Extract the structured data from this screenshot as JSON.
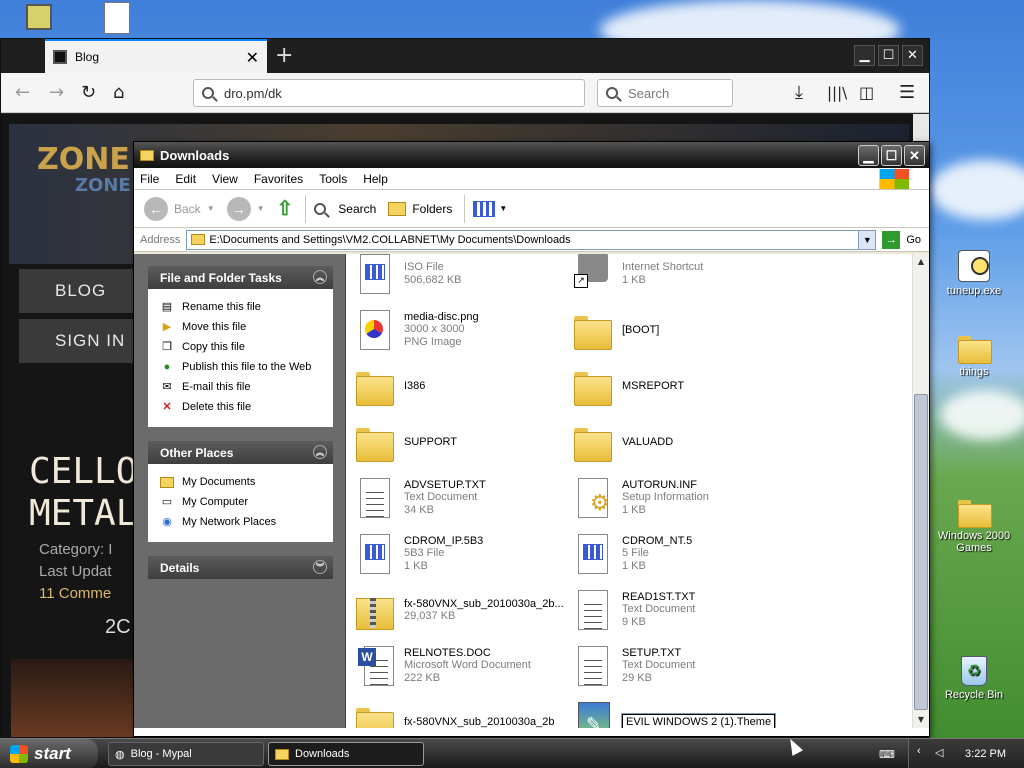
{
  "desktop": {
    "icons": [
      {
        "label": "tuneup.exe",
        "icon": "clock-exe-icon"
      },
      {
        "label": "things",
        "icon": "folder-icon"
      },
      {
        "label": "Windows 2000 Games",
        "icon": "folder-icon"
      },
      {
        "label": "Recycle Bin",
        "icon": "recycle-bin-icon"
      }
    ]
  },
  "browser": {
    "tab_title": "Blog",
    "url": "dro.pm/dk",
    "search_placeholder": "Search",
    "page": {
      "logo": "ZONE",
      "logo_sub": "ZONE",
      "menu": [
        "BLOG",
        "SIGN IN"
      ],
      "post_title_line1": "CELLO",
      "post_title_line2": "METAL",
      "meta": [
        "Category: I",
        "Last Updat",
        "11 Comme"
      ],
      "date_fragment": "2C"
    }
  },
  "explorer": {
    "title": "Downloads",
    "menu": [
      "File",
      "Edit",
      "View",
      "Favorites",
      "Tools",
      "Help"
    ],
    "toolbar": {
      "back": "Back",
      "search": "Search",
      "folders": "Folders"
    },
    "address_label": "Address",
    "address": "E:\\Documents and Settings\\VM2.COLLABNET\\My Documents\\Downloads",
    "go": "Go",
    "file_tasks": {
      "title": "File and Folder Tasks",
      "items": [
        "Rename this file",
        "Move this file",
        "Copy this file",
        "Publish this file to the Web",
        "E-mail this file",
        "Delete this file"
      ]
    },
    "other_places": {
      "title": "Other Places",
      "items": [
        "My Documents",
        "My Computer",
        "My Network Places"
      ]
    },
    "details_title": "Details",
    "files": [
      {
        "name": "",
        "type": "ISO File",
        "size": "506,682 KB",
        "icon": "grid"
      },
      {
        "name": "",
        "type": "Internet Shortcut",
        "size": "1 KB",
        "icon": "shortcut"
      },
      {
        "name": "media-disc.png",
        "type": "3000 x 3000",
        "size": "PNG Image",
        "icon": "img"
      },
      {
        "name": "[BOOT]",
        "type": "",
        "size": "",
        "icon": "folder"
      },
      {
        "name": "I386",
        "type": "",
        "size": "",
        "icon": "folder"
      },
      {
        "name": "MSREPORT",
        "type": "",
        "size": "",
        "icon": "folder"
      },
      {
        "name": "SUPPORT",
        "type": "",
        "size": "",
        "icon": "folder"
      },
      {
        "name": "VALUADD",
        "type": "",
        "size": "",
        "icon": "folder"
      },
      {
        "name": "ADVSETUP.TXT",
        "type": "Text Document",
        "size": "34 KB",
        "icon": "doc"
      },
      {
        "name": "AUTORUN.INF",
        "type": "Setup Information",
        "size": "1 KB",
        "icon": "setup"
      },
      {
        "name": "CDROM_IP.5B3",
        "type": "5B3 File",
        "size": "1 KB",
        "icon": "grid"
      },
      {
        "name": "CDROM_NT.5",
        "type": "5 File",
        "size": "1 KB",
        "icon": "grid"
      },
      {
        "name": "fx-580VNX_sub_2010030a_2b...",
        "type": "29,037 KB",
        "size": "",
        "icon": "zip"
      },
      {
        "name": "READ1ST.TXT",
        "type": "Text Document",
        "size": "9 KB",
        "icon": "doc"
      },
      {
        "name": "RELNOTES.DOC",
        "type": "Microsoft Word Document",
        "size": "222 KB",
        "icon": "word"
      },
      {
        "name": "SETUP.TXT",
        "type": "Text Document",
        "size": "29 KB",
        "icon": "doc"
      },
      {
        "name": "fx-580VNX_sub_2010030a_2b",
        "type": "",
        "size": "",
        "icon": "folder"
      },
      {
        "name": "EVIL WINDOWS 2 (1).Theme",
        "type": "",
        "size": "",
        "icon": "theme"
      }
    ]
  },
  "taskbar": {
    "start": "start",
    "tasks": [
      "Blog - Mypal",
      "Downloads"
    ],
    "clock": "3:22 PM"
  }
}
